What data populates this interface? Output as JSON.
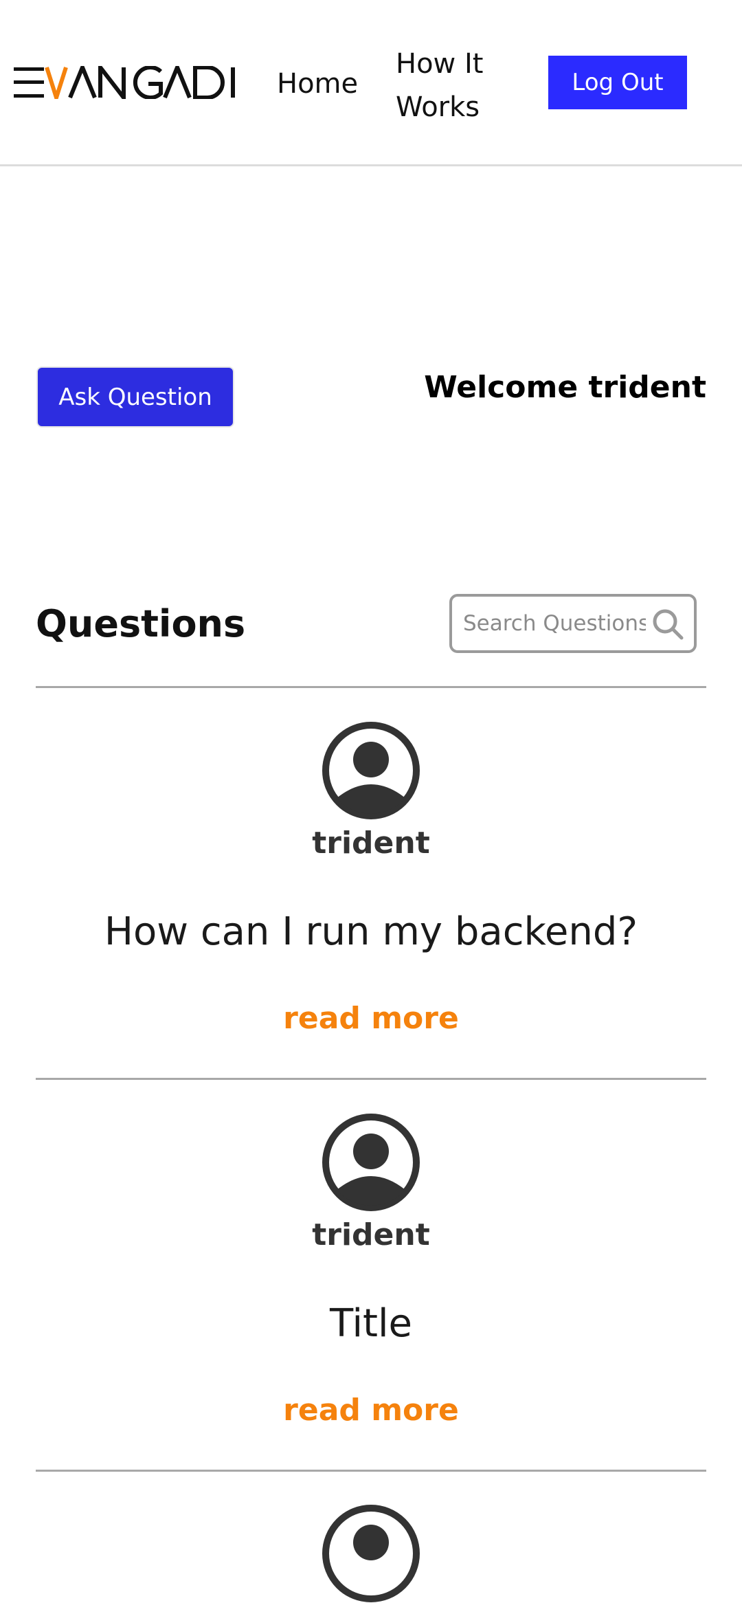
{
  "header": {
    "logo_text": "EVANGADI",
    "nav": {
      "home": "Home",
      "how_it_works": "How It Works"
    },
    "logout_label": "Log Out"
  },
  "main": {
    "ask_question_label": "Ask Question",
    "welcome_text": "Welcome trident",
    "questions_title": "Questions",
    "search": {
      "placeholder": "Search Questions"
    },
    "questions": [
      {
        "user": "trident",
        "title": "How can I run my backend?",
        "link": "read more"
      },
      {
        "user": "trident",
        "title": "Title",
        "link": "read more"
      }
    ]
  },
  "colors": {
    "primary_blue": "#2b2bff",
    "accent_orange": "#f5820d"
  }
}
